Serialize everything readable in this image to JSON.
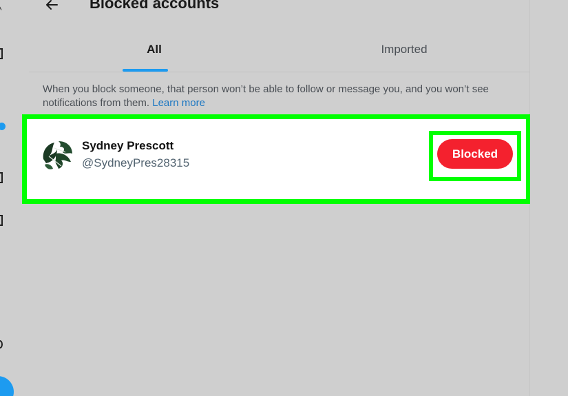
{
  "header": {
    "title": "Blocked accounts",
    "back_icon": "arrow-left-icon"
  },
  "tabs": [
    {
      "label": "All",
      "selected": true
    },
    {
      "label": "Imported",
      "selected": false
    }
  ],
  "info": {
    "text": "When you block someone, that person won’t be able to follow or message you, and you won’t see notifications from them.",
    "link": "Learn more"
  },
  "blocked_list": [
    {
      "name": "Sydney Prescott",
      "handle": "@SydneyPres28315",
      "button_label": "Blocked"
    }
  ],
  "colors": {
    "accent": "#1d9bf0",
    "blocked_button": "#f4212e",
    "highlight": "#00ff00",
    "link": "#1a76c2"
  }
}
